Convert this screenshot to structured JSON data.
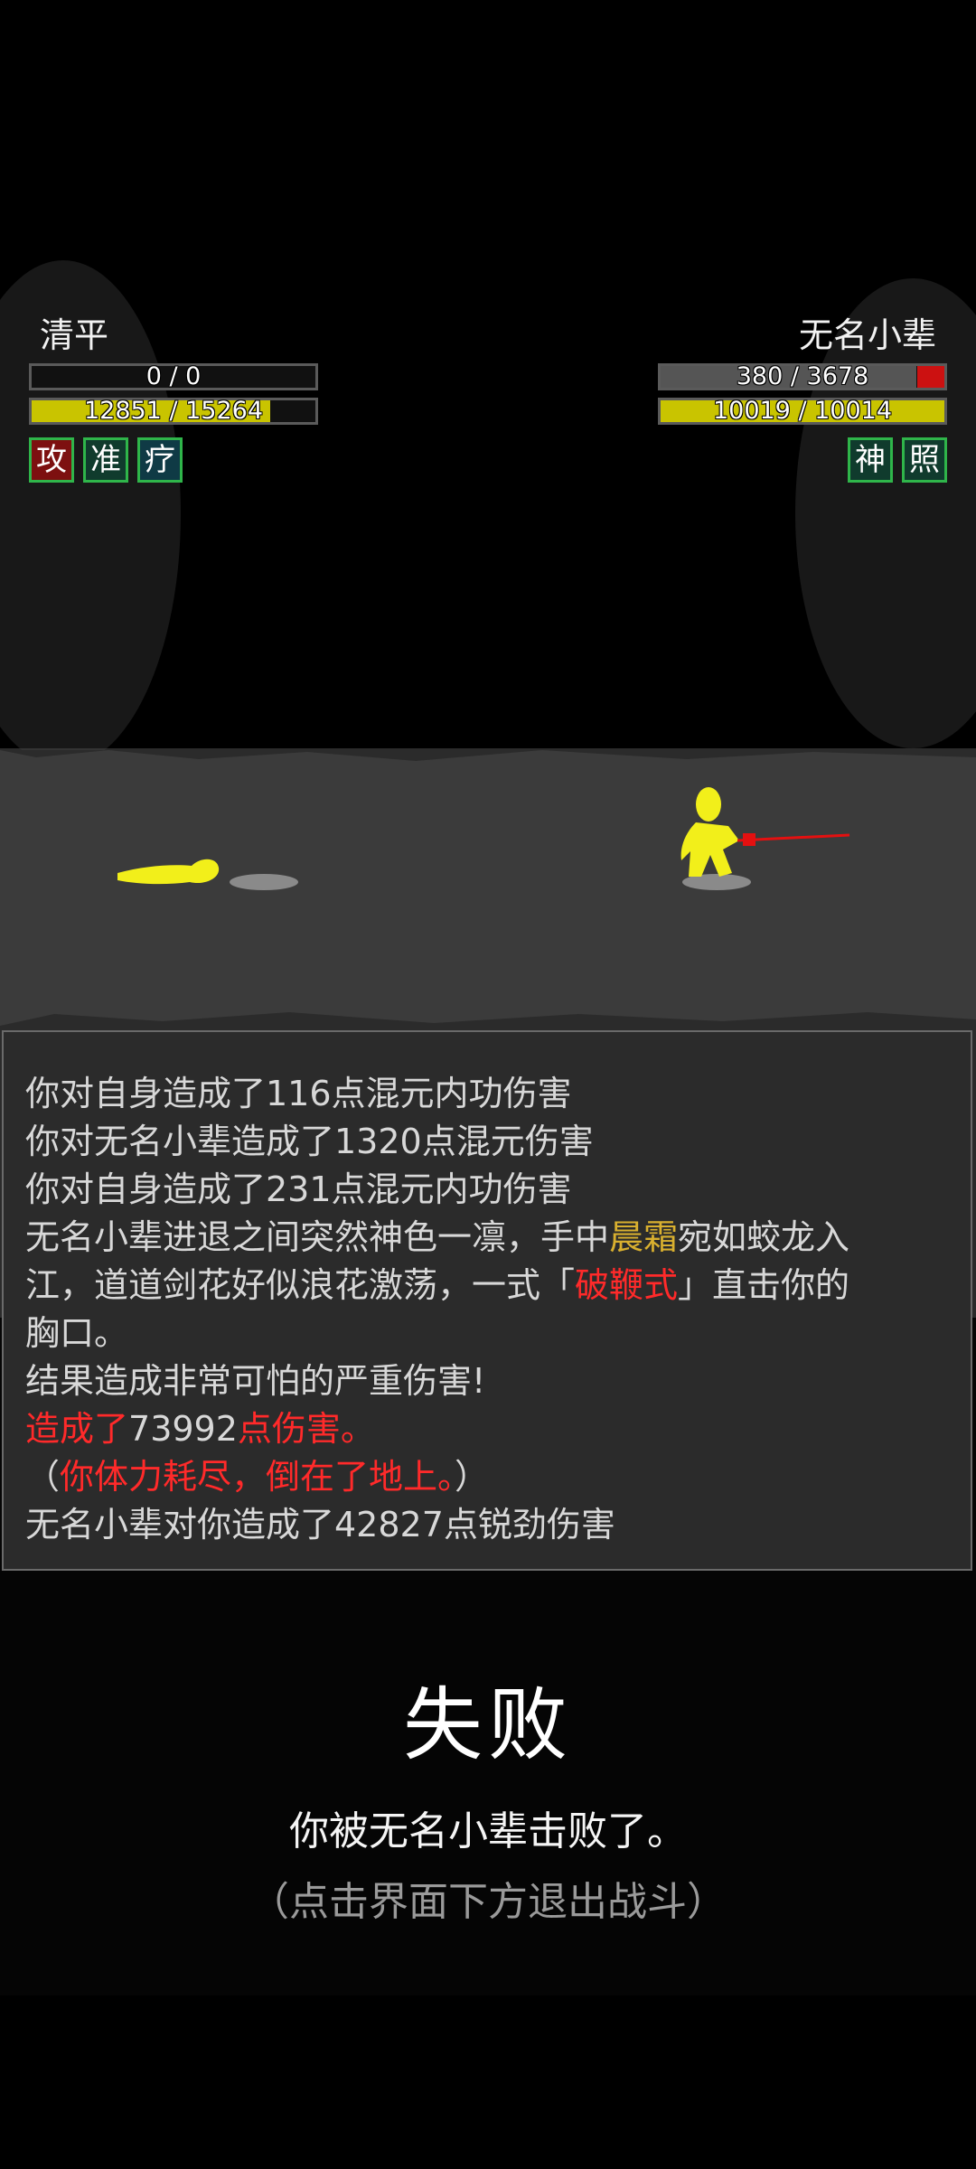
{
  "player": {
    "name": "清平",
    "bar1_text": "0 / 0",
    "bar1_fill": 0,
    "hp_text": "12851 / 15264",
    "hp_fill": 0.84,
    "buffs": [
      "攻",
      "准",
      "疗"
    ]
  },
  "enemy": {
    "name": "无名小辈",
    "bar1_text": "380 / 3678",
    "bar1_fill": 0.9,
    "hp_text": "10019 / 10014",
    "hp_fill": 1.0,
    "buffs": [
      "神",
      "照"
    ]
  },
  "log": {
    "lines": [
      [
        {
          "t": "你对自身造成了116点混元内功伤害"
        }
      ],
      [
        {
          "t": "你对无名小辈造成了1320点混元伤害"
        }
      ],
      [
        {
          "t": "你对自身造成了231点混元内功伤害"
        }
      ],
      [
        {
          "t": "无名小辈进退之间突然神色一凛，手中"
        },
        {
          "t": "晨霜",
          "c": "gold"
        },
        {
          "t": "宛如蛟龙入"
        }
      ],
      [
        {
          "t": "江，道道剑花好似浪花激荡，一式「"
        },
        {
          "t": "破鞭式",
          "c": "red"
        },
        {
          "t": "」直击你的"
        }
      ],
      [
        {
          "t": "胸口。"
        }
      ],
      [
        {
          "t": "结果造成非常可怕的严重伤害!"
        }
      ],
      [
        {
          "t": "造成了",
          "c": "red"
        },
        {
          "t": "73992"
        },
        {
          "t": "点伤害。",
          "c": "red"
        }
      ],
      [
        {
          "t": "（"
        },
        {
          "t": "你体力耗尽，倒在了地上。",
          "c": "red"
        },
        {
          "t": "）"
        }
      ],
      [
        {
          "t": "无名小辈对你造成了42827点锐劲伤害"
        }
      ]
    ]
  },
  "result": {
    "title": "失败",
    "message": "你被无名小辈击败了。",
    "hint": "（点击界面下方退出战斗）"
  },
  "colors": {
    "hp_yellow": "#c9c400",
    "hit_red": "#cc1111",
    "highlight_gold": "#d9b02f",
    "highlight_red": "#ff2a2a",
    "buff_border": "#2fb54a"
  }
}
